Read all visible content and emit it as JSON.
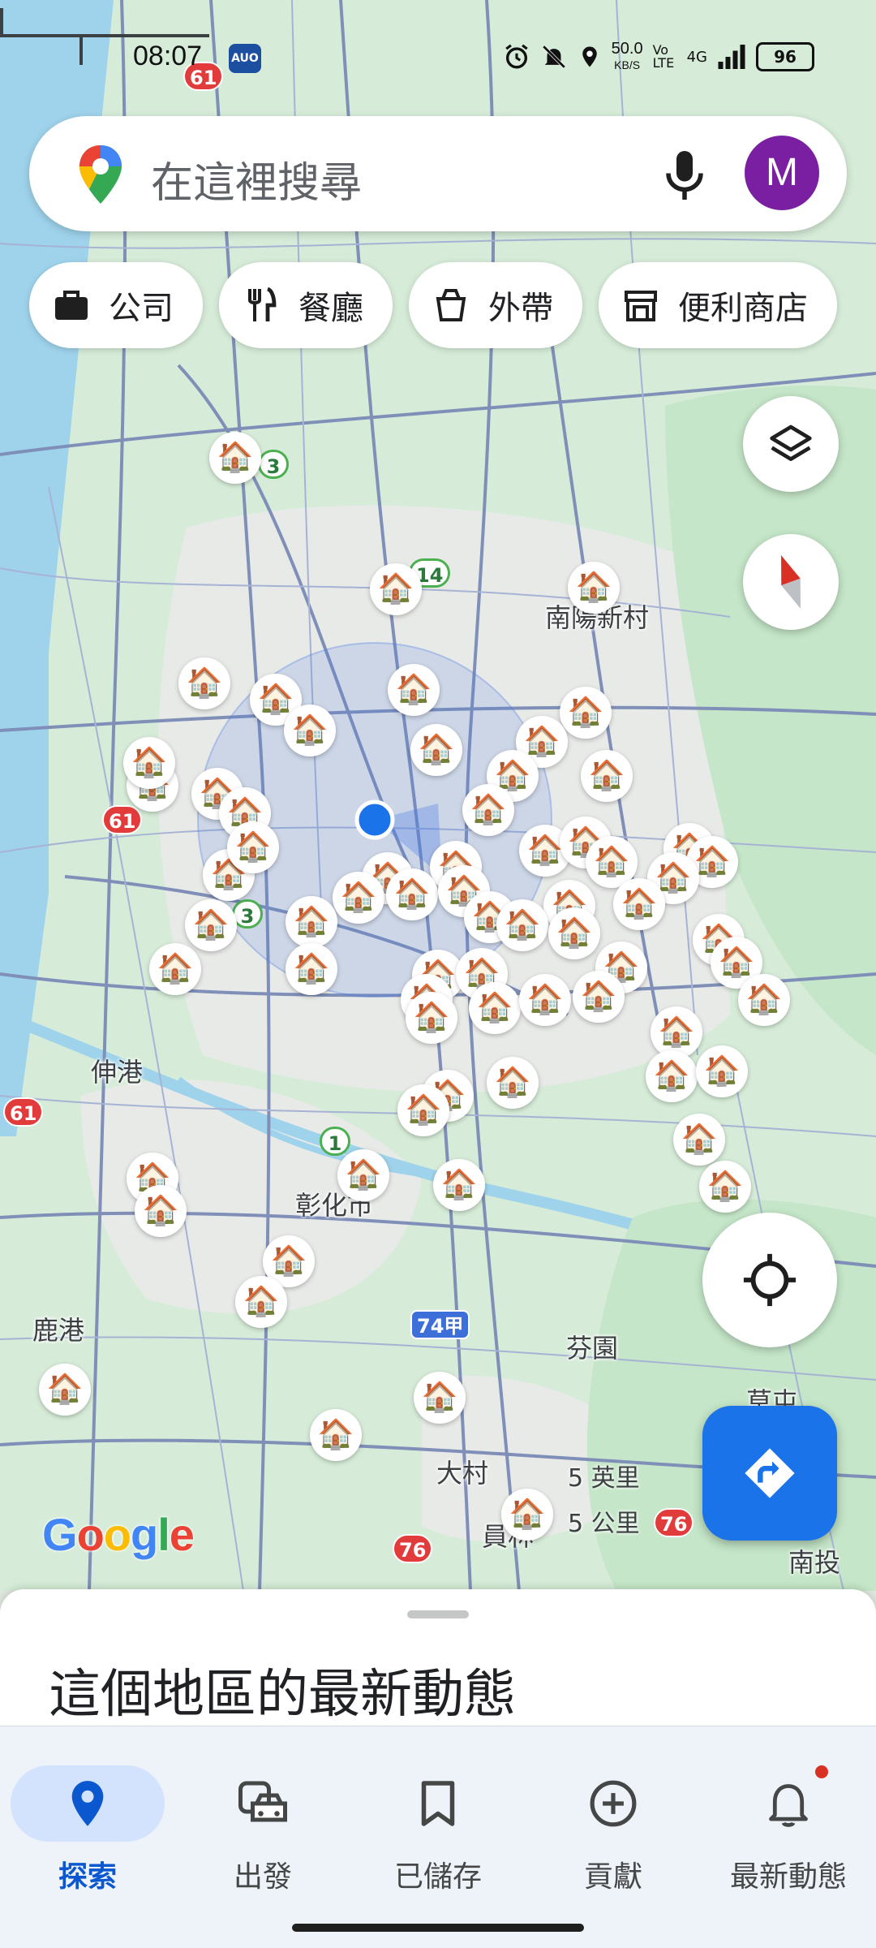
{
  "status_bar": {
    "time": "08:07",
    "app_badge": "AUO",
    "net_speed_value": "50.0",
    "net_speed_unit": "KB/S",
    "volte": "Vo LTE",
    "network": "4G",
    "battery": "96"
  },
  "search": {
    "placeholder": "在這裡搜尋",
    "avatar_letter": "M"
  },
  "chips": [
    {
      "label": "公司",
      "icon": "briefcase-icon"
    },
    {
      "label": "餐廳",
      "icon": "restaurant-icon"
    },
    {
      "label": "外帶",
      "icon": "takeout-icon"
    },
    {
      "label": "便利商店",
      "icon": "store-icon"
    }
  ],
  "map": {
    "places": {
      "nanyang": "南陽新村",
      "shengang": "伸港",
      "changhua": "彰化市",
      "lukang": "鹿港",
      "fenyuan": "芬園",
      "caotun": "草屯",
      "dacun": "大村",
      "yuanlin": "員林",
      "nantou": "南投"
    },
    "routes": {
      "r61a": "61",
      "r61b": "61",
      "r61c": "61",
      "r74": "74甲",
      "r76a": "76",
      "r76b": "76",
      "r3a": "3",
      "r3b": "3",
      "r1": "1",
      "r14": "14"
    },
    "google": "Google",
    "scale_miles": "5 英里",
    "scale_km": "5 公里"
  },
  "sheet": {
    "title": "這個地區的最新動態"
  },
  "nav": [
    {
      "label": "探索",
      "icon": "explore-pin-icon",
      "active": true
    },
    {
      "label": "出發",
      "icon": "commute-car-icon",
      "active": false
    },
    {
      "label": "已儲存",
      "icon": "bookmark-icon",
      "active": false
    },
    {
      "label": "貢獻",
      "icon": "add-circle-icon",
      "active": false
    },
    {
      "label": "最新動態",
      "icon": "bell-icon",
      "active": false
    }
  ],
  "colors": {
    "accent": "#1a73e8",
    "avatar": "#7b1fa2",
    "location_dot": "#1a73e8"
  }
}
